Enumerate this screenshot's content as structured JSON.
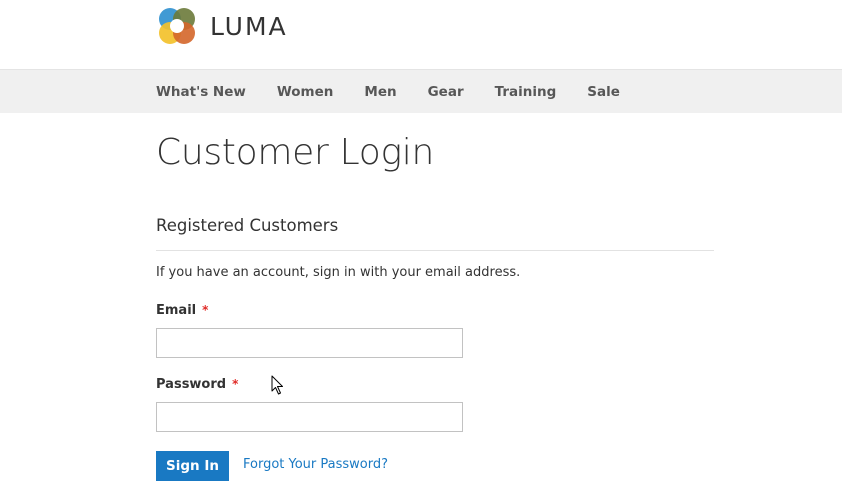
{
  "header": {
    "logo_text": "LUMA",
    "logo_icon": "luma-logo-icon"
  },
  "nav": {
    "items": [
      {
        "label": "What's New"
      },
      {
        "label": "Women"
      },
      {
        "label": "Men"
      },
      {
        "label": "Gear"
      },
      {
        "label": "Training"
      },
      {
        "label": "Sale"
      }
    ]
  },
  "main": {
    "title": "Customer Login",
    "block_title": "Registered Customers",
    "intro": "If you have an account, sign in with your email address.",
    "email": {
      "label": "Email",
      "required_marker": "*",
      "value": ""
    },
    "password": {
      "label": "Password",
      "required_marker": "*",
      "value": ""
    },
    "sign_in_label": "Sign In",
    "forgot_label": "Forgot Your Password?"
  },
  "colors": {
    "accent": "#1979c3",
    "nav_background": "#f0f0f0",
    "required": "#e02b27",
    "text": "#333333"
  },
  "icons": {
    "cursor": "mouse-pointer-icon"
  }
}
